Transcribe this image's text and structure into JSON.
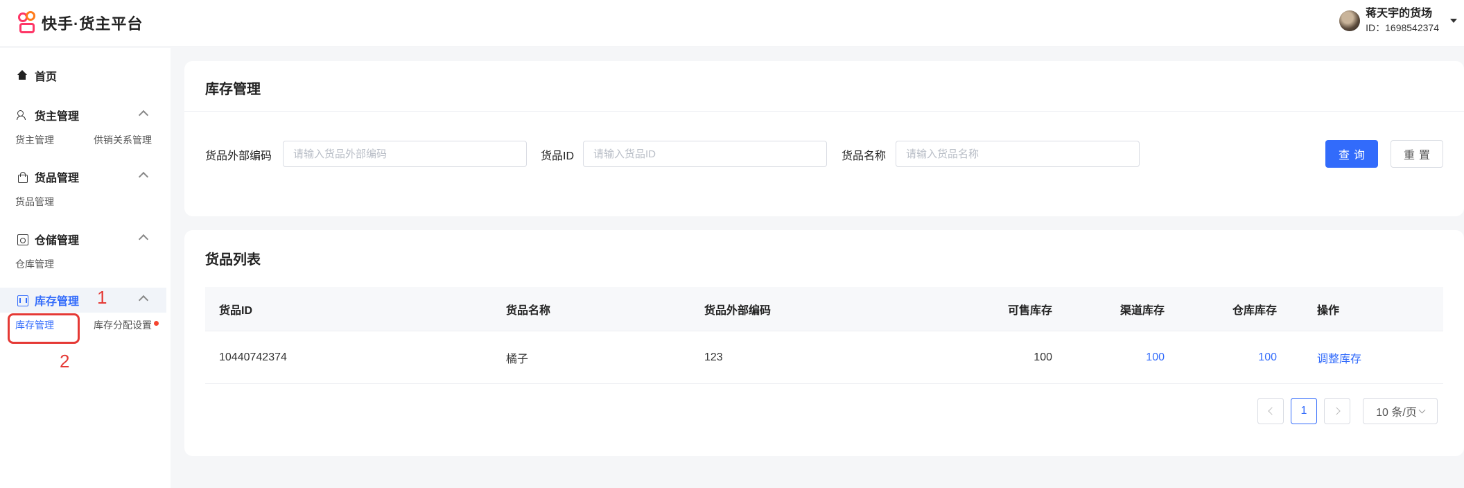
{
  "header": {
    "logo_text": "快手·货主平台",
    "user_name": "蒋天宇的货场",
    "user_id": "ID：1698542374"
  },
  "sidebar": {
    "home": "首页",
    "groups": [
      {
        "label": "货主管理",
        "items": [
          "货主管理",
          "供销关系管理"
        ]
      },
      {
        "label": "货品管理",
        "items": [
          "货品管理"
        ]
      },
      {
        "label": "仓储管理",
        "items": [
          "仓库管理"
        ]
      },
      {
        "label": "库存管理",
        "items": [
          "库存管理",
          "库存分配设置"
        ],
        "active": true
      }
    ]
  },
  "annotations": {
    "n1": "1",
    "n2": "2"
  },
  "search_card": {
    "title": "库存管理",
    "fields": [
      {
        "label": "货品外部编码",
        "placeholder": "请输入货品外部编码"
      },
      {
        "label": "货品ID",
        "placeholder": "请输入货品ID"
      },
      {
        "label": "货品名称",
        "placeholder": "请输入货品名称"
      }
    ],
    "query_button": "查询",
    "reset_button": "重置"
  },
  "list_card": {
    "title": "货品列表",
    "columns": [
      "货品ID",
      "货品名称",
      "货品外部编码",
      "可售库存",
      "渠道库存",
      "仓库库存",
      "操作"
    ],
    "rows": [
      {
        "id": "10440742374",
        "name": "橘子",
        "code": "123",
        "sellable": "100",
        "channel": "100",
        "warehouse": "100",
        "action": "调整库存"
      }
    ],
    "pagination": {
      "current": "1",
      "page_size": "10 条/页"
    }
  },
  "colors": {
    "accent": "#326bfb",
    "annotation": "#e53935"
  }
}
